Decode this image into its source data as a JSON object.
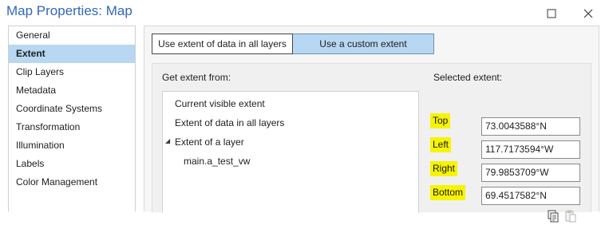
{
  "window": {
    "title": "Map Properties: Map",
    "maximize_icon": "maximize-icon",
    "close_icon": "close-icon"
  },
  "sidebar": {
    "items": [
      {
        "label": "General",
        "active": false
      },
      {
        "label": "Extent",
        "active": true
      },
      {
        "label": "Clip Layers",
        "active": false
      },
      {
        "label": "Metadata",
        "active": false
      },
      {
        "label": "Coordinate Systems",
        "active": false
      },
      {
        "label": "Transformation",
        "active": false
      },
      {
        "label": "Illumination",
        "active": false
      },
      {
        "label": "Labels",
        "active": false
      },
      {
        "label": "Color Management",
        "active": false
      }
    ]
  },
  "extent": {
    "tabs": [
      {
        "label": "Use extent of data in all layers",
        "selected": false
      },
      {
        "label": "Use a custom extent",
        "selected": true
      }
    ],
    "get_extent_label": "Get extent from:",
    "sources": [
      "Current visible extent",
      "Extent of data in all layers",
      "Extent of a layer",
      "main.a_test_vw"
    ],
    "selected_label": "Selected extent:",
    "fields": {
      "top": {
        "label": "Top",
        "value": "73.0043588°N"
      },
      "left": {
        "label": "Left",
        "value": "117.7173594°W"
      },
      "right": {
        "label": "Right",
        "value": "79.9853709°W"
      },
      "bottom": {
        "label": "Bottom",
        "value": "69.4517582°N"
      }
    },
    "copy_icon": "copy-icon",
    "paste_icon": "paste-icon"
  },
  "colors": {
    "title": "#3367b8",
    "selection": "#b7d7f2",
    "highlight": "#f7f400"
  }
}
